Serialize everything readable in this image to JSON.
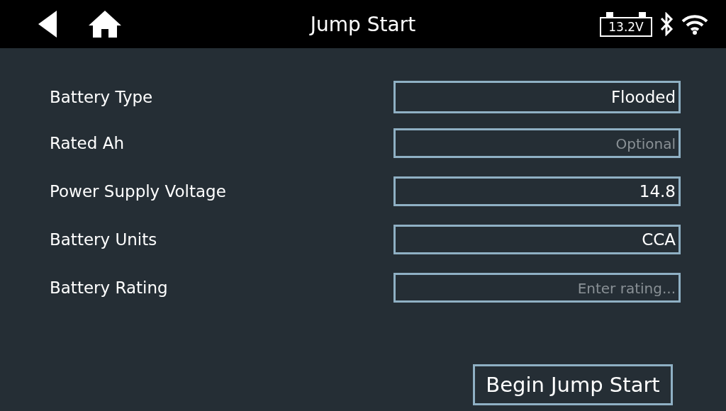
{
  "header": {
    "title": "Jump Start",
    "battery_voltage": "13.2V"
  },
  "fields": [
    {
      "label": "Battery Type",
      "value": "Flooded"
    },
    {
      "label": "Rated Ah",
      "placeholder": "Optional"
    },
    {
      "label": "Power Supply Voltage",
      "value": "14.8"
    },
    {
      "label": "Battery Units",
      "value": "CCA"
    },
    {
      "label": "Battery Rating",
      "placeholder": "Enter rating..."
    }
  ],
  "buttons": [
    "Begin Jump Start"
  ]
}
